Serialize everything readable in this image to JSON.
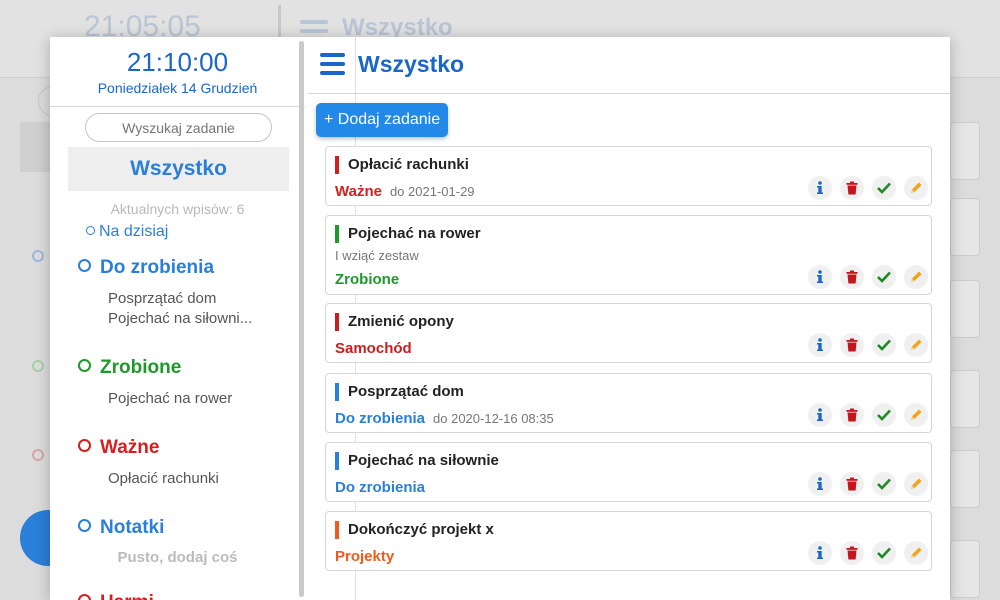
{
  "background": {
    "clock": "21:05:05",
    "title": "Wszystko"
  },
  "sidebar": {
    "clock": "21:10:00",
    "date": "Poniedziałek 14 Grudzień",
    "search_placeholder": "Wyszukaj zadanie",
    "all_label": "Wszystko",
    "count_text": "Aktualnych wpisów: 6",
    "today_label": "Na dzisiaj",
    "categories": [
      {
        "name": "Do zrobienia",
        "color": "#2a7fd8",
        "items": [
          "Posprzątać dom",
          "Pojechać na siłowni..."
        ]
      },
      {
        "name": "Zrobione",
        "color": "#1e9a2a",
        "items": [
          "Pojechać na rower"
        ]
      },
      {
        "name": "Ważne",
        "color": "#d21f1f",
        "items": [
          "Opłacić rachunki"
        ]
      },
      {
        "name": "Notatki",
        "color": "#2a7fd8",
        "empty_text": "Pusto, dodaj coś"
      },
      {
        "name": "Harmi...",
        "color": "#d21f1f"
      }
    ]
  },
  "main": {
    "title": "Wszystko",
    "add_button": "+ Dodaj zadanie",
    "tasks": [
      {
        "title": "Opłacić rachunki",
        "category": "Ważne",
        "color": "#d21f1f",
        "date": "do 2021-01-29"
      },
      {
        "title": "Pojechać na rower",
        "description": "I wziąć zestaw",
        "category": "Zrobione",
        "color": "#1e9a2a"
      },
      {
        "title": "Zmienić opony",
        "category": "Samochód",
        "color": "#c82020"
      },
      {
        "title": "Posprzątać dom",
        "category": "Do zrobienia",
        "color": "#2a7fd8",
        "date": "do 2020-12-16 08:35"
      },
      {
        "title": "Pojechać na siłownie",
        "category": "Do zrobienia",
        "color": "#2a7fd8"
      },
      {
        "title": "Dokończyć projekt x",
        "category": "Projekty",
        "color": "#f05a1a"
      }
    ]
  },
  "icons": {
    "info": "info-icon",
    "delete": "trash-icon",
    "done": "check-icon",
    "edit": "pencil-icon"
  }
}
